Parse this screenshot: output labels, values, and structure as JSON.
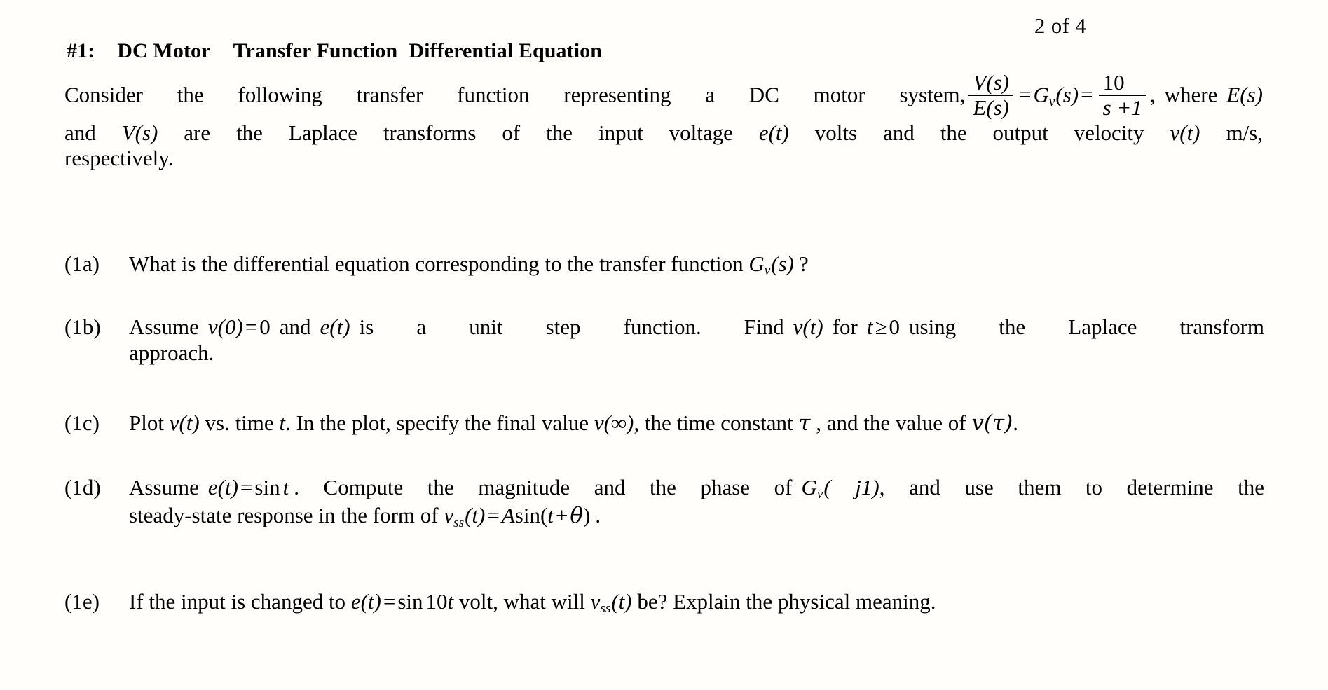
{
  "header": {
    "page_indicator": "2 of 4"
  },
  "title": {
    "number": "#1:",
    "part1": "DC Motor",
    "part2": "Transfer Function",
    "part3": "Differential Equation"
  },
  "intro": {
    "line1_before": "Consider the following transfer function representing a DC motor system,",
    "fraction1_num": "V(s)",
    "fraction1_den": "E(s)",
    "eq1": "=",
    "gv": "G",
    "gv_sub": "v",
    "gv_arg": "(s)",
    "eq2": "=",
    "fraction2_num": "10",
    "fraction2_den": "s +1",
    "comma": ",",
    "where": "where",
    "es": "E(s)",
    "line2": "and  V(s)  are  the  Laplace  transforms  of  the  input  voltage  e(t)  volts  and  the  output  velocity  v(t)  m/s,",
    "line2_a": "and",
    "line2_vs": "V(s)",
    "line2_b": "are the Laplace transforms of the input voltage",
    "line2_et": "e(t)",
    "line2_c": "volts and the output velocity",
    "line2_vt": "v(t)",
    "line2_d": "m/s,",
    "line3": "respectively."
  },
  "items": [
    {
      "label": "(1a)",
      "text_a": "What is the differential equation corresponding to the transfer function",
      "math_g": "G",
      "math_g_sub": "v",
      "math_g_arg": "(s)",
      "text_b": "?"
    },
    {
      "label": "(1b)",
      "line1_a": "Assume",
      "math_v0": "v(0)",
      "math_eq": "=",
      "math_zero": "0",
      "line1_b": "and",
      "math_et": "e(t)",
      "line1_c": "is  a  unit  step  function.  Find",
      "math_vt": "v(t)",
      "line1_d": "for",
      "math_t": "t",
      "math_ge": "≥",
      "math_t0": "0",
      "line1_e": "using  the  Laplace  transform",
      "line2": "approach."
    },
    {
      "label": "(1c)",
      "text_a": "Plot",
      "math_vt": "v(t)",
      "text_b": "vs. time",
      "math_t": "t",
      "text_c": ". In the plot, specify the final value",
      "math_vinf": "v(∞)",
      "text_d": ", the time constant",
      "math_tau": "τ",
      "text_e": ", and the value of",
      "math_vtau": "v(τ)",
      "text_f": "."
    },
    {
      "label": "(1d)",
      "line1_a": "Assume",
      "math_et": "e(t)",
      "math_eq": "=",
      "math_sin": "sin",
      "math_t": "t",
      "line1_b": ". Compute  the  magnitude  and  the  phase  of",
      "math_gvj1": "G",
      "math_gvj1_sub": "v",
      "math_gvj1_arg": "( j1)",
      "line1_c": ",  and  use  them  to  determine  the",
      "line2_a": "steady-state response in the form of",
      "math_vss": "v",
      "math_vss_sub": "ss",
      "math_vss_arg": "(t)",
      "math_vss_eq": "=",
      "math_A": "A",
      "math_sin2": "sin(",
      "math_arg2": "t",
      "math_plus": "+",
      "math_theta": "θ",
      "math_close": ")",
      "line2_b": "."
    },
    {
      "label": "(1e)",
      "text_a": "If the input is changed to",
      "math_et": "e(t)",
      "math_eq": "=",
      "math_sin": "sin",
      "math_10": "10",
      "math_t": "t",
      "text_b": "volt, what will",
      "math_vss": "v",
      "math_vss_sub": "ss",
      "math_vss_arg": "(t)",
      "text_c": "be?  Explain the physical meaning."
    }
  ],
  "style": {
    "background": "#fffefb",
    "text_color": "#000000"
  }
}
